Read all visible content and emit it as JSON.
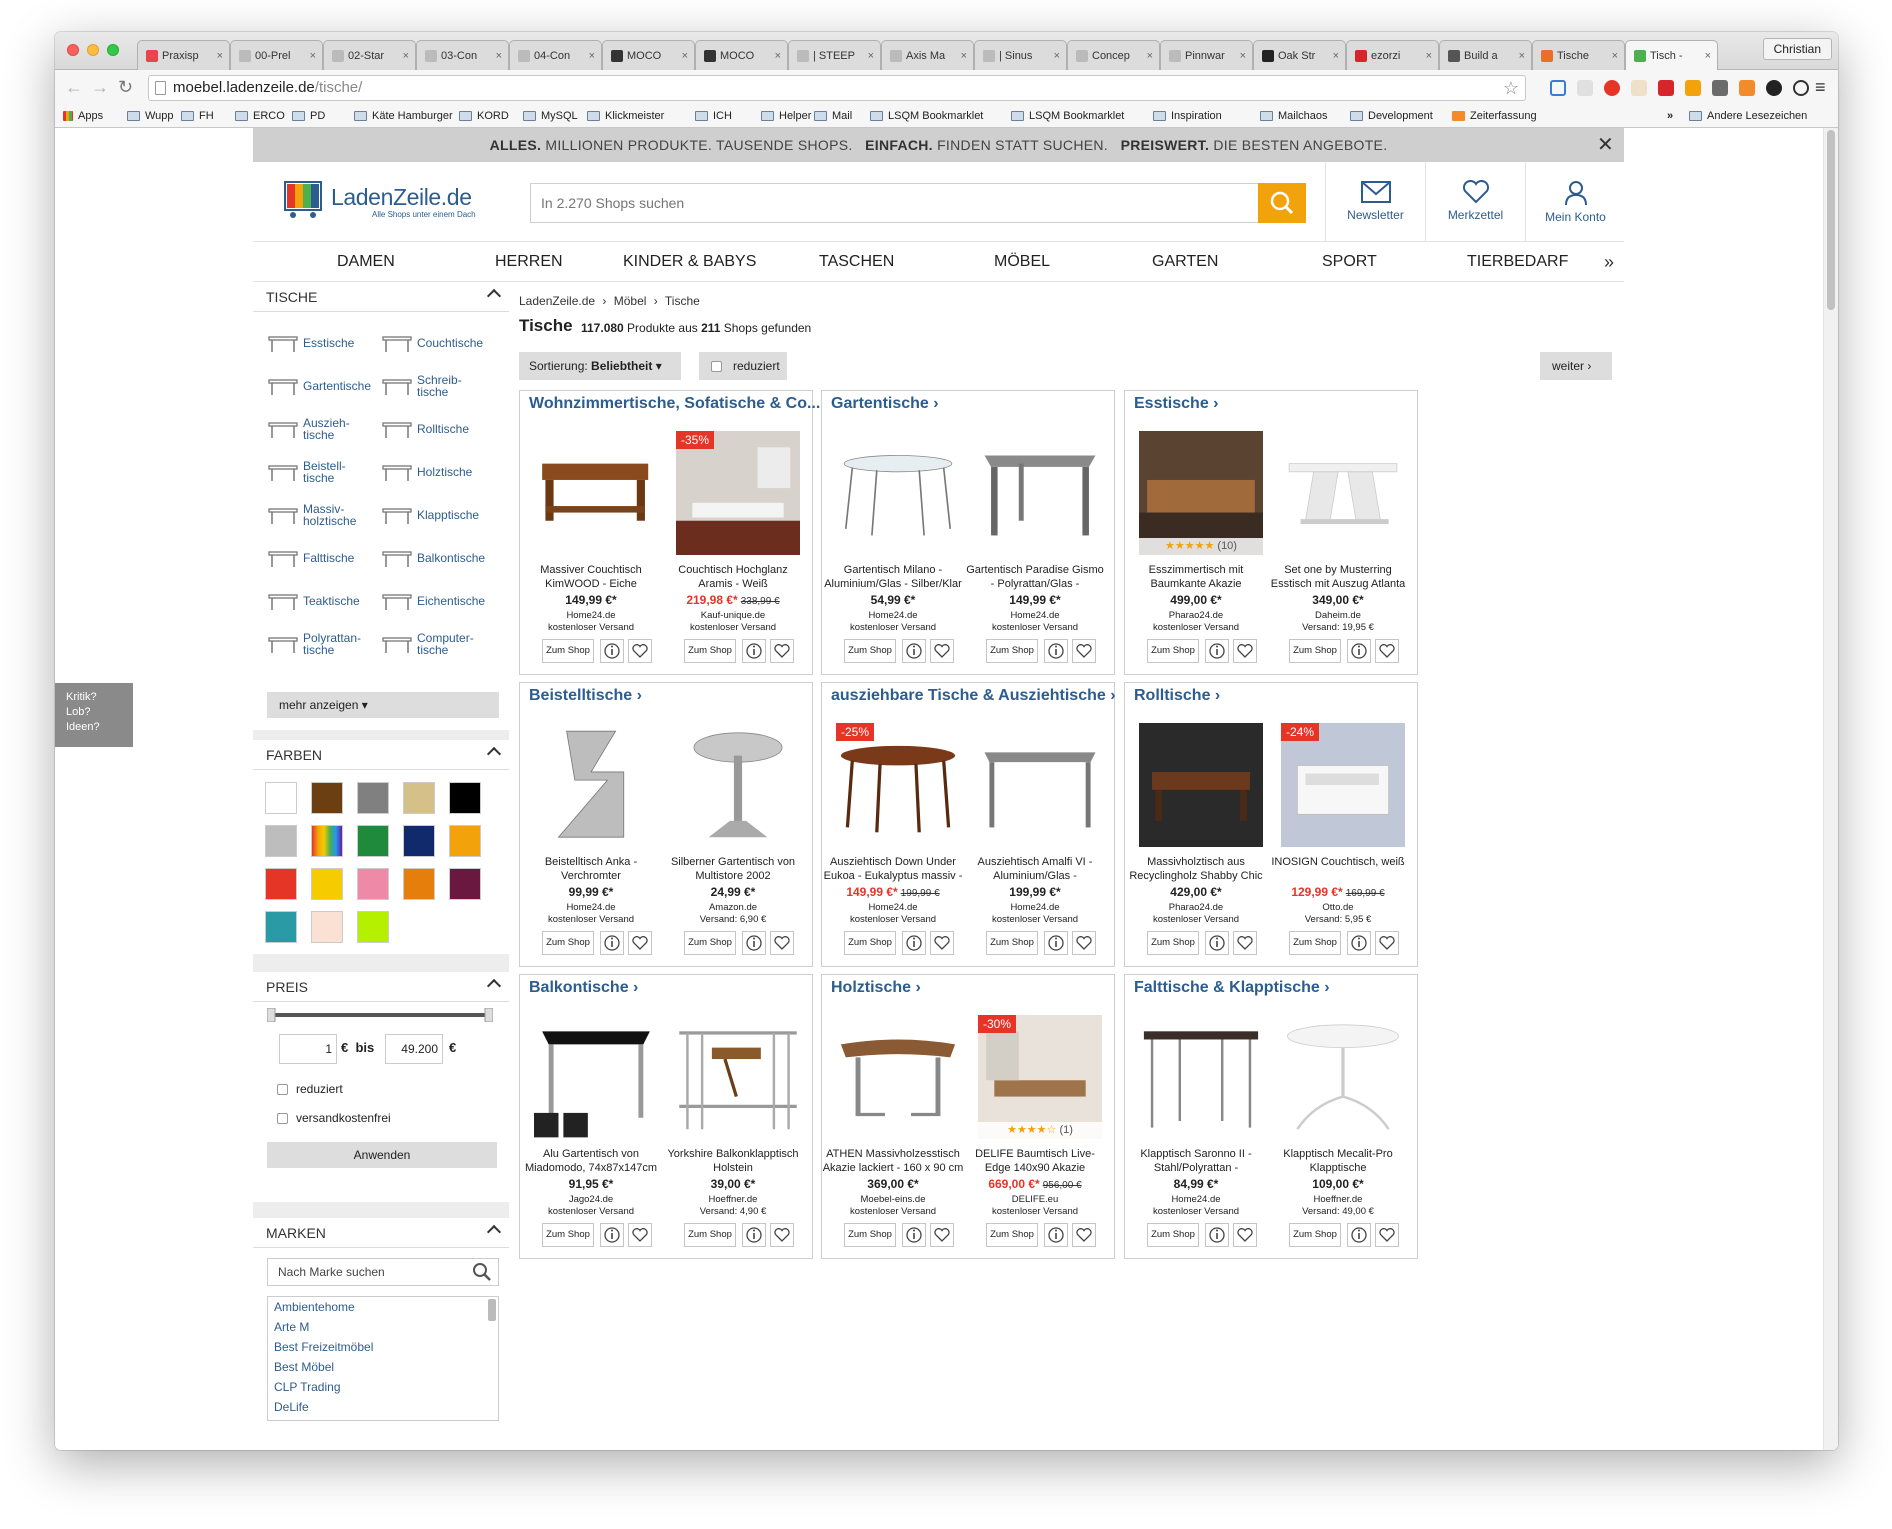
{
  "browser": {
    "tabs": [
      {
        "title": "Praxisp",
        "fav": "#e8454f"
      },
      {
        "title": "00-Prel",
        "fav": "#bbbbbb"
      },
      {
        "title": "02-Star",
        "fav": "#bbbbbb"
      },
      {
        "title": "03-Con",
        "fav": "#bbbbbb"
      },
      {
        "title": "04-Con",
        "fav": "#bbbbbb"
      },
      {
        "title": "MOCO",
        "fav": "#333333"
      },
      {
        "title": "MOCO",
        "fav": "#333333"
      },
      {
        "title": "| STEEP",
        "fav": "#bbbbbb"
      },
      {
        "title": "Axis Ma",
        "fav": "#bbbbbb"
      },
      {
        "title": "| Sinus",
        "fav": "#bbbbbb"
      },
      {
        "title": "Concep",
        "fav": "#bbbbbb"
      },
      {
        "title": "Pinnwar",
        "fav": "#bbbbbb"
      },
      {
        "title": "Oak Str",
        "fav": "#222222"
      },
      {
        "title": "ezorzi",
        "fav": "#d6262c"
      },
      {
        "title": "Build a",
        "fav": "#555555"
      },
      {
        "title": "Tische",
        "fav": "#e8702a"
      },
      {
        "title": "Tisch -",
        "fav": "#4caf50"
      }
    ],
    "profile": "Christian",
    "url_host": "moebel.ladenzeile.de",
    "url_path": "/tische/",
    "bookmarks": [
      "Apps",
      "Wupp",
      "FH",
      "ERCO",
      "PD",
      "Käte Hamburger",
      "KORD",
      "MySQL",
      "Klickmeister",
      "ICH",
      "Helper",
      "Mail",
      "LSQM Bookmarklet",
      "LSQM Bookmarklet",
      "Inspiration",
      "Mailchaos",
      "Development",
      "Zeiterfassung",
      "Andere Lesezeichen"
    ]
  },
  "feedback": [
    "Kritik?",
    "Lob?",
    "Ideen?"
  ],
  "promo": {
    "a": "ALLES.",
    "a2": "MILLIONEN PRODUKTE. TAUSENDE SHOPS.",
    "b": "EINFACH.",
    "b2": "FINDEN STATT SUCHEN.",
    "c": "PREISWERT.",
    "c2": "DIE BESTEN ANGEBOTE."
  },
  "header": {
    "logo_name": "LadenZeile.de",
    "logo_tag": "Alle Shops unter einem Dach",
    "search_placeholder": "In 2.270 Shops suchen",
    "newsletter": "Newsletter",
    "merkzettel": "Merkzettel",
    "konto": "Mein Konto"
  },
  "categories": [
    "DAMEN",
    "HERREN",
    "KINDER & BABYS",
    "TASCHEN",
    "MÖBEL",
    "GARTEN",
    "SPORT",
    "TIERBEDARF"
  ],
  "sidebar": {
    "tische_title": "TISCHE",
    "tische_items": [
      {
        "l1": "Esstische",
        "l2": ""
      },
      {
        "l1": "Couchtische",
        "l2": ""
      },
      {
        "l1": "Gartentische",
        "l2": ""
      },
      {
        "l1": "Schreib-",
        "l2": "tische"
      },
      {
        "l1": "Auszieh-",
        "l2": "tische"
      },
      {
        "l1": "Rolltische",
        "l2": ""
      },
      {
        "l1": "Beistell-",
        "l2": "tische"
      },
      {
        "l1": "Holztische",
        "l2": ""
      },
      {
        "l1": "Massiv-",
        "l2": "holztische"
      },
      {
        "l1": "Klapptische",
        "l2": ""
      },
      {
        "l1": "Falttische",
        "l2": ""
      },
      {
        "l1": "Balkontische",
        "l2": ""
      },
      {
        "l1": "Teaktische",
        "l2": ""
      },
      {
        "l1": "Eichentische",
        "l2": ""
      },
      {
        "l1": "Polyrattan-",
        "l2": "tische"
      },
      {
        "l1": "Computer-",
        "l2": "tische"
      }
    ],
    "mehr": "mehr anzeigen",
    "farben_title": "FARBEN",
    "colors": [
      "#ffffff",
      "#6b3f12",
      "#808080",
      "#d6c08a",
      "#000000",
      "#bdbdbd",
      "rainbow",
      "#1f8a3c",
      "#102a6b",
      "#f2a20b",
      "#e53526",
      "#f6cb00",
      "#ee8aa8",
      "#e67e0c",
      "#6a1840",
      "#2a9aa4",
      "#fbe0d4",
      "#b4f000"
    ],
    "preis_title": "PREIS",
    "price_min": "1",
    "price_max": "49.200",
    "euro": "€",
    "bis": "€  bis",
    "reduziert": "reduziert",
    "versand": "versandkostenfrei",
    "anwenden": "Anwenden",
    "marken_title": "MARKEN",
    "marken_placeholder": "Nach Marke suchen",
    "brands": [
      "Ambientehome",
      "Arte M",
      "Best Freizeitmöbel",
      "Best Möbel",
      "CLP Trading",
      "DeLife"
    ]
  },
  "main": {
    "crumbs": [
      "LadenZeile.de",
      "›",
      "Möbel",
      "›",
      "Tische"
    ],
    "title": "Tische",
    "count_a": "117.080",
    "count_b": " Produkte aus ",
    "count_c": "211",
    "count_d": " Shops gefunden",
    "sort_label": "Sortierung: ",
    "sort_value": "Beliebtheit",
    "reduziert": "reduziert",
    "weiter": "weiter",
    "zum_shop": "Zum Shop"
  },
  "cards": [
    {
      "title": "Wohnzimmertische, Sofatische & Co...",
      "products": [
        {
          "name": "Massiver Couchtisch KimWOOD - Eiche",
          "price": "149,99 €*",
          "old": "",
          "sale": false,
          "shop": "Home24.de",
          "ship": "kostenloser Versand",
          "badge": "",
          "stars": "",
          "img": "couch_wood"
        },
        {
          "name": "Couchtisch Hochglanz Aramis - Weiß",
          "price": "219,98 €*",
          "old": "338,99 €",
          "sale": true,
          "shop": "Kauf-unique.de",
          "ship": "kostenloser Versand",
          "badge": "-35%",
          "stars": "",
          "img": "room"
        }
      ]
    },
    {
      "title": "Gartentische",
      "products": [
        {
          "name": "Gartentisch Milano - Aluminium/Glas - Silber/Klar",
          "price": "54,99 €*",
          "old": "",
          "sale": false,
          "shop": "Home24.de",
          "ship": "kostenloser Versand",
          "badge": "",
          "stars": "",
          "img": "glass"
        },
        {
          "name": "Gartentisch Paradise Gismo - Polyrattan/Glas -",
          "price": "149,99 €*",
          "old": "",
          "sale": false,
          "shop": "Home24.de",
          "ship": "kostenloser Versand",
          "badge": "",
          "stars": "",
          "img": "grey_table"
        }
      ]
    },
    {
      "title": "Esstische",
      "products": [
        {
          "name": "Esszimmertisch mit Baumkante Akazie",
          "price": "499,00 €*",
          "old": "",
          "sale": false,
          "shop": "Pharao24.de",
          "ship": "kostenloser Versand",
          "badge": "",
          "stars": "★★★★★",
          "rating": "(10)",
          "img": "dining"
        },
        {
          "name": "Set one by Musterring Esstisch mit Auszug Atlanta",
          "price": "349,00 €*",
          "old": "",
          "sale": false,
          "shop": "Daheim.de",
          "ship": "Versand: 19,95 €",
          "badge": "",
          "stars": "",
          "img": "white_v"
        }
      ]
    },
    {
      "title": "Beistelltische",
      "products": [
        {
          "name": "Beistelltisch Anka - Verchromter",
          "price": "99,99 €*",
          "old": "",
          "sale": false,
          "shop": "Home24.de",
          "ship": "kostenloser Versand",
          "badge": "",
          "stars": "",
          "img": "chrome_z"
        },
        {
          "name": "Silberner Gartentisch von Multistore 2002",
          "price": "24,99 €*",
          "old": "",
          "sale": false,
          "shop": "Amazon.de",
          "ship": "Versand: 6,90 €",
          "badge": "",
          "stars": "",
          "img": "bistro"
        }
      ]
    },
    {
      "title": "ausziehbare Tische & Ausziehtische",
      "products": [
        {
          "name": "Ausziehtisch Down Under Eukoa - Eukalyptus massiv -",
          "price": "149,99 €*",
          "old": "199,99 €",
          "sale": true,
          "shop": "Home24.de",
          "ship": "kostenloser Versand",
          "badge": "-25%",
          "stars": "",
          "img": "oval_wood"
        },
        {
          "name": "Ausziehtisch Amalfi VI - Aluminium/Glas -",
          "price": "199,99 €*",
          "old": "",
          "sale": false,
          "shop": "Home24.de",
          "ship": "kostenloser Versand",
          "badge": "",
          "stars": "",
          "img": "grey_glass"
        }
      ]
    },
    {
      "title": "Rolltische",
      "products": [
        {
          "name": "Massivholztisch aus Recyclingholz Shabby Chic",
          "price": "429,00 €*",
          "old": "",
          "sale": false,
          "shop": "Pharao24.de",
          "ship": "kostenloser Versand",
          "badge": "",
          "stars": "",
          "img": "dark_room"
        },
        {
          "name": "INOSIGN Couchtisch, weiß",
          "price": "129,99 €*",
          "old": "169,99 €",
          "sale": true,
          "shop": "Otto.de",
          "ship": "Versand: 5,95 €",
          "badge": "-24%",
          "stars": "",
          "img": "white_roll"
        }
      ]
    },
    {
      "title": "Balkontische",
      "products": [
        {
          "name": "Alu Gartentisch von Miadomodo, 74x87x147cm",
          "price": "91,95 €*",
          "old": "",
          "sale": false,
          "shop": "Jago24.de",
          "ship": "kostenloser Versand",
          "badge": "",
          "stars": "",
          "img": "black_top"
        },
        {
          "name": "Yorkshire Balkonklapptisch Holstein",
          "price": "39,00 €*",
          "old": "",
          "sale": false,
          "shop": "Hoeffner.de",
          "ship": "Versand: 4,90 €",
          "badge": "",
          "stars": "",
          "img": "balcony"
        }
      ]
    },
    {
      "title": "Holztische",
      "products": [
        {
          "name": "ATHEN Massivholzesstisch Akazie lackiert - 160 x 90 cm",
          "price": "369,00 €*",
          "old": "",
          "sale": false,
          "shop": "Moebel-eins.de",
          "ship": "kostenloser Versand",
          "badge": "",
          "stars": "",
          "img": "live_edge"
        },
        {
          "name": "DELIFE Baumtisch Live-Edge 140x90 Akazie",
          "price": "669,00 €*",
          "old": "956,00 €",
          "sale": true,
          "shop": "DELIFE.eu",
          "ship": "kostenloser Versand",
          "badge": "-30%",
          "stars": "★★★★☆",
          "rating": "(1)",
          "img": "bright_room"
        }
      ]
    },
    {
      "title": "Falttische & Klapptische",
      "products": [
        {
          "name": "Klapptisch Saronno II - Stahl/Polyrattan -",
          "price": "84,99 €*",
          "old": "",
          "sale": false,
          "shop": "Home24.de",
          "ship": "kostenloser Versand",
          "badge": "",
          "stars": "",
          "img": "fold_dark"
        },
        {
          "name": "Klapptisch Mecalit-Pro Klapptische",
          "price": "109,00 €*",
          "old": "",
          "sale": false,
          "shop": "Hoeffner.de",
          "ship": "Versand: 49,00 €",
          "badge": "",
          "stars": "",
          "img": "round_white"
        }
      ]
    }
  ]
}
